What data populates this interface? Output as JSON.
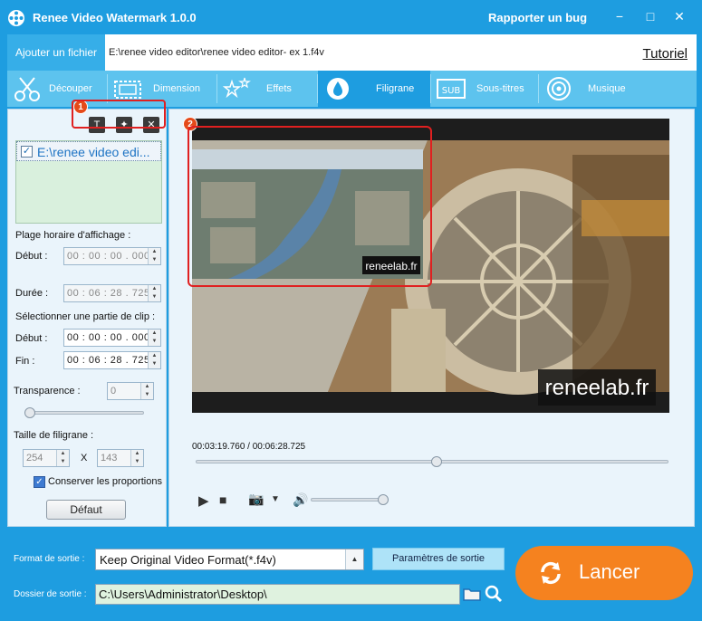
{
  "app": {
    "title": "Renee Video Watermark 1.0.0",
    "bug_report": "Rapporter un bug",
    "win_buttons": {
      "minimize": "−",
      "maximize": "□",
      "close": "✕"
    }
  },
  "top": {
    "add_file": "Ajouter un fichier",
    "file_path": "E:\\renee video editor\\renee video editor- ex 1.f4v",
    "tutorial": "Tutoriel"
  },
  "tabs": [
    {
      "label": "Découper",
      "icon": "scissors-icon"
    },
    {
      "label": "Dimension",
      "icon": "crop-icon"
    },
    {
      "label": "Effets",
      "icon": "stars-icon"
    },
    {
      "label": "Filigrane",
      "icon": "droplet-icon",
      "active": true
    },
    {
      "label": "Sous-titres",
      "icon": "subtitle-icon"
    },
    {
      "label": "Musique",
      "icon": "music-icon"
    }
  ],
  "left": {
    "badge1": "1",
    "tools": {
      "add": "T",
      "add_image": "✦",
      "remove": "✕"
    },
    "file_item": "E:\\renee video edi...",
    "file_checked": "✓",
    "display_range": "Plage horaire d'affichage :",
    "debut_label": "Début :",
    "debut_value": "00 : 00 : 00 . 000",
    "duree_label": "Durée :",
    "duree_value": "00 : 06 : 28 . 725",
    "select_clip": "Sélectionner une partie de clip :",
    "clip_debut_label": "Début :",
    "clip_debut_value": "00 : 00 : 00 . 000",
    "fin_label": "Fin :",
    "fin_value": "00 : 06 : 28 . 725",
    "transparency_label": "Transparence :",
    "transparency_value": "0",
    "transparency_level": 0,
    "size_label": "Taille de filigrane :",
    "width_value": "254",
    "x_sep": "X",
    "height_value": "143",
    "keep_ratio": "Conserver les proportions",
    "keep_ratio_check": "✓",
    "default_button": "Défaut"
  },
  "preview": {
    "badge2": "2",
    "watermark_small": "reneelab.fr",
    "watermark_large": "reneelab.fr",
    "time": "00:03:19.760 / 00:06:28.725",
    "progress": 0.51,
    "volume": 1.0,
    "play": "▶",
    "stop": "■",
    "camera": "📷",
    "camera_dd": "▼",
    "volume_icon": "🔊"
  },
  "bottom": {
    "format_label": "Format de sortie :",
    "format_value": "Keep Original Video Format(*.f4v)",
    "params_button": "Paramètres de sortie",
    "folder_label": "Dossier de sortie :",
    "folder_value": "C:\\Users\\Administrator\\Desktop\\",
    "launch": "Lancer"
  }
}
